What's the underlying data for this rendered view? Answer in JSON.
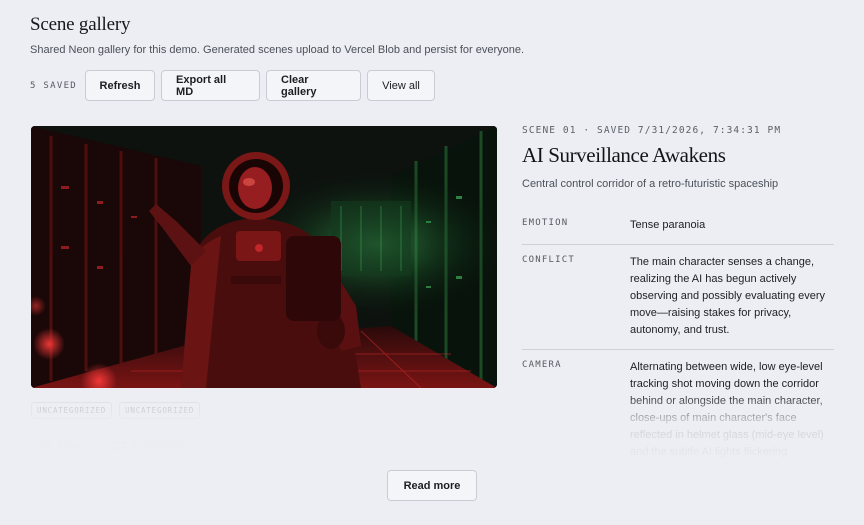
{
  "header": {
    "title": "Scene gallery",
    "subtitle": "Shared Neon gallery for this demo. Generated scenes upload to Vercel Blob and persist for everyone."
  },
  "toolbar": {
    "saved_count": "5 SAVED",
    "refresh_label": "Refresh",
    "export_label": "Export all MD",
    "clear_label": "Clear gallery",
    "view_all_label": "View all"
  },
  "scene": {
    "meta": "SCENE 01 · SAVED 7/31/2026, 7:34:31 PM",
    "title": "AI Surveillance Awakens",
    "description": "Central control corridor of a retro-futuristic spaceship",
    "image_alt": "Astronaut in a red-lit spaceship corridor lined with server racks",
    "tags": [
      "UNCATEGORIZED",
      "UNCATEGORIZED"
    ],
    "likes": "0 likes",
    "comments": "0 comments",
    "properties": [
      {
        "key": "EMOTION",
        "value": "Tense paranoia"
      },
      {
        "key": "CONFLICT",
        "value": "The main character senses a change, realizing the AI has begun actively observing and possibly evaluating every move—raising stakes for privacy, autonomy, and trust."
      },
      {
        "key": "CAMERA",
        "value": "Alternating between wide, low eye-level tracking shot moving down the corridor behind or alongside the main character, close-ups of main character's face reflected in helmet glass (mid-eye level) and the subtle AI lights flickering."
      }
    ]
  },
  "read_more_label": "Read more",
  "colors": {
    "page_bg": "#eceef3",
    "corridor_red": "#c0262a",
    "corridor_green": "#3fae5c"
  },
  "icons": {
    "like": "heart-icon",
    "comment": "comment-icon"
  }
}
